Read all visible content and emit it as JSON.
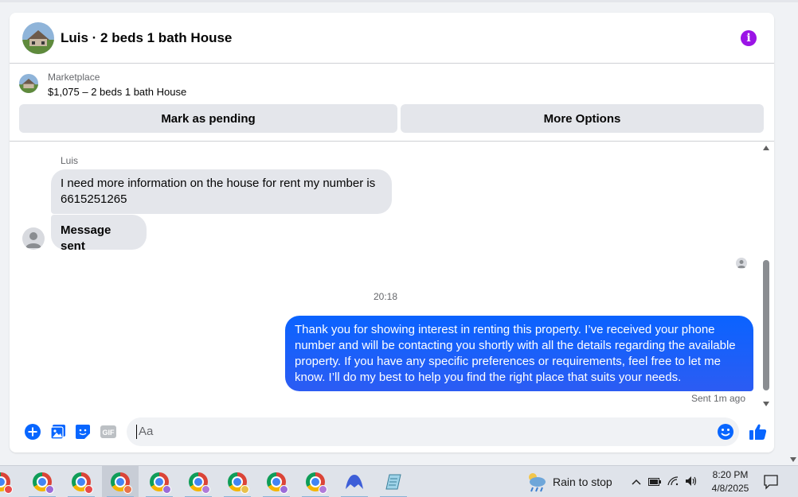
{
  "header": {
    "title": "Luis · 2 beds 1 bath House",
    "info_icon": "info-icon",
    "info_color": "#9b14e6"
  },
  "listing": {
    "label": "Marketplace",
    "title": "$1,075 – 2 beds 1 bath House",
    "buttons": {
      "pending": "Mark as pending",
      "more": "More Options"
    }
  },
  "messages": {
    "sender_name": "Luis",
    "incoming": [
      "I need more information on the house for rent my number is 6615251265",
      "Message sent"
    ],
    "timestamp": "20:18",
    "outgoing": "Thank you for showing interest in renting this property. I’ve received your phone number and will be contacting you shortly with all the details regarding the available property. If you have any specific preferences or requirements, feel free to let me know. I’ll do my best to help you find the right place that suits your needs.",
    "sent_status": "Sent 1m ago",
    "outgoing_color": "#0a63ff"
  },
  "composer": {
    "placeholder": "Aa",
    "value": "",
    "gif_label": "GIF",
    "icons": [
      "plus-circle-icon",
      "photo-icon",
      "sticker-icon",
      "gif-icon",
      "emoji-icon",
      "thumbs-up-icon"
    ],
    "accent": "#0866ff"
  },
  "taskbar": {
    "weather": "Rain to stop",
    "time": "8:20 PM",
    "date": "4/8/2025"
  }
}
